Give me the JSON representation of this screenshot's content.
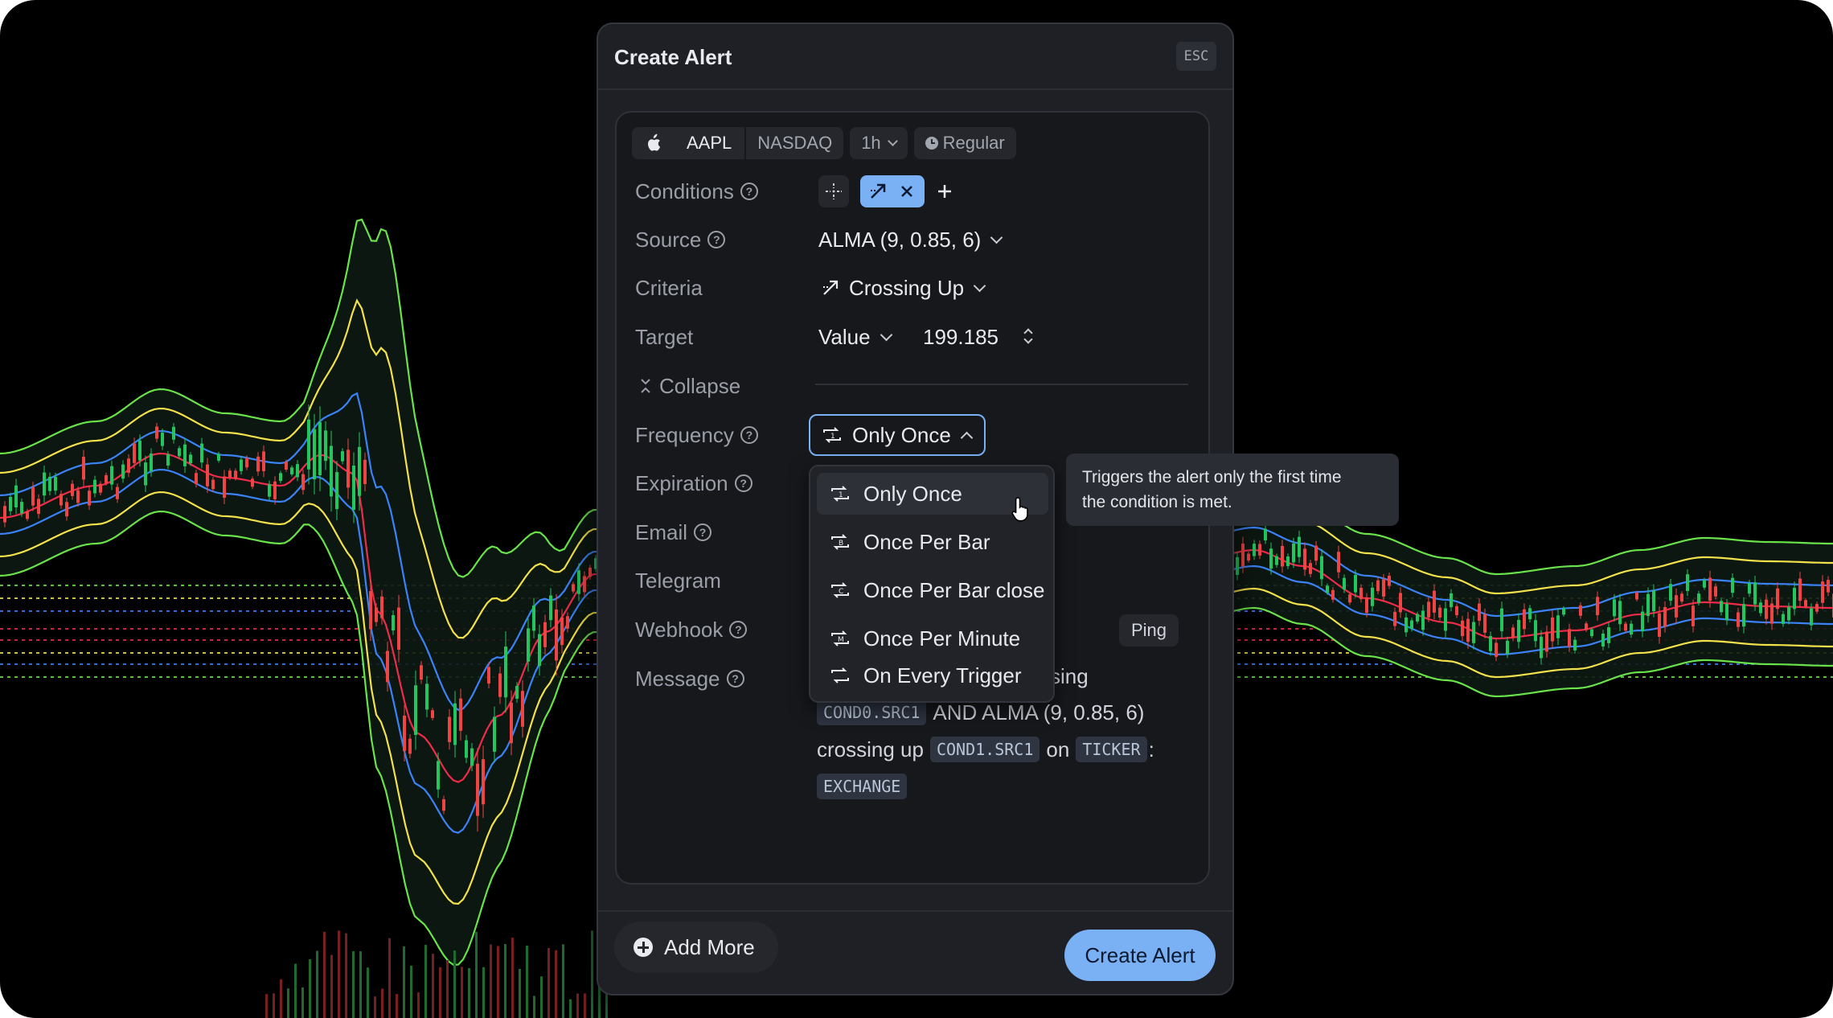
{
  "dialog": {
    "title": "Create Alert",
    "esc_label": "ESC"
  },
  "symbol": {
    "ticker": "AAPL",
    "exchange": "NASDAQ",
    "interval": "1h",
    "session": "Regular"
  },
  "form": {
    "conditions_label": "Conditions",
    "source_label": "Source",
    "source_value": "ALMA (9, 0.85, 6)",
    "criteria_label": "Criteria",
    "criteria_value": "Crossing Up",
    "target_label": "Target",
    "target_type": "Value",
    "target_value": "199.185",
    "collapse_label": "Collapse",
    "frequency_label": "Frequency",
    "frequency_value": "Only Once",
    "expiration_label": "Expiration",
    "email_label": "Email",
    "telegram_label": "Telegram",
    "webhook_label": "Webhook",
    "ping_label": "Ping",
    "message_label": "Message"
  },
  "message": {
    "line1_tail": "sing",
    "tok_cond0": "COND0.SRC1",
    "line2_text": "AND ALMA (9, 0.85, 6)",
    "crossing_up": "crossing up",
    "tok_cond1": "COND1.SRC1",
    "on": "on",
    "tok_ticker": "TICKER",
    "colon": ":",
    "tok_exchange": "EXCHANGE"
  },
  "frequency_options": [
    {
      "label": "Only Once",
      "icon": "repeat-1-icon"
    },
    {
      "label": "Once Per Bar",
      "icon": "repeat-bar-icon"
    },
    {
      "label": "Once Per Bar close",
      "icon": "repeat-close-icon"
    },
    {
      "label": "Once Per Minute",
      "icon": "repeat-minute-icon"
    },
    {
      "label": "On Every Trigger",
      "icon": "repeat-icon"
    }
  ],
  "tooltip": {
    "line1": "Triggers the alert only the first time",
    "line2": "the condition is met."
  },
  "footer": {
    "add_more": "Add More",
    "create": "Create Alert"
  },
  "colors": {
    "accent": "#7ab1f5",
    "background": "#000000",
    "dialog": "#1e2025",
    "up": "#22c55e",
    "down": "#ef4444"
  },
  "chart_data": {
    "type": "line",
    "series": [
      {
        "color": "#6ae34a"
      },
      {
        "color": "#f2e14a"
      },
      {
        "color": "#3b82f6"
      },
      {
        "color": "#ef2b4a"
      }
    ]
  }
}
